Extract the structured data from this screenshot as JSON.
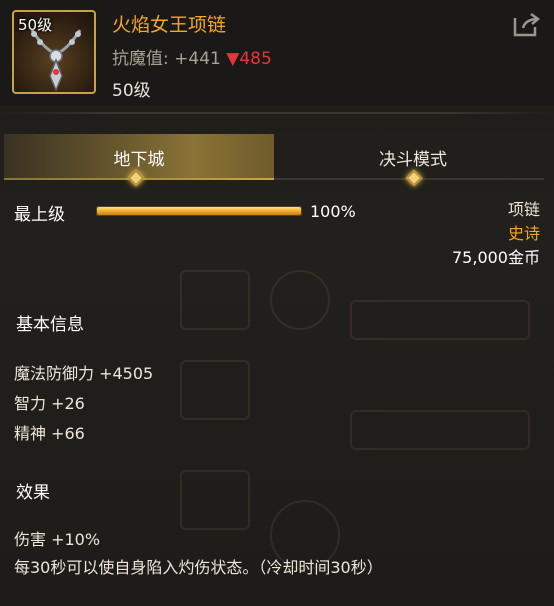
{
  "item": {
    "icon_level": "50级",
    "name": "火焰女王项链",
    "stat_label": "抗魔值:",
    "stat_value": "+441",
    "stat_compare": "▼485",
    "level": "50级"
  },
  "tabs": [
    {
      "label": "地下城",
      "active": true
    },
    {
      "label": "决斗模式",
      "active": false
    }
  ],
  "grade": {
    "label": "最上级",
    "progress": 1.0,
    "percent_text": "100%"
  },
  "meta": {
    "type": "项链",
    "rarity": "史诗",
    "price": "75,000金币"
  },
  "basic_info": {
    "title": "基本信息",
    "stats": [
      "魔法防御力 +4505",
      "智力 +26",
      "精神 +66"
    ]
  },
  "effect": {
    "title": "效果",
    "lines": [
      "伤害 +10%",
      "每30秒可以使自身陷入灼伤状态。（冷却时间30秒）"
    ]
  },
  "colors": {
    "title_orange": "#f5a623",
    "down_red": "#e8343a",
    "frame_gold": "#c8a24a"
  },
  "icons": {
    "share": "share-icon",
    "item": "necklace-icon"
  }
}
